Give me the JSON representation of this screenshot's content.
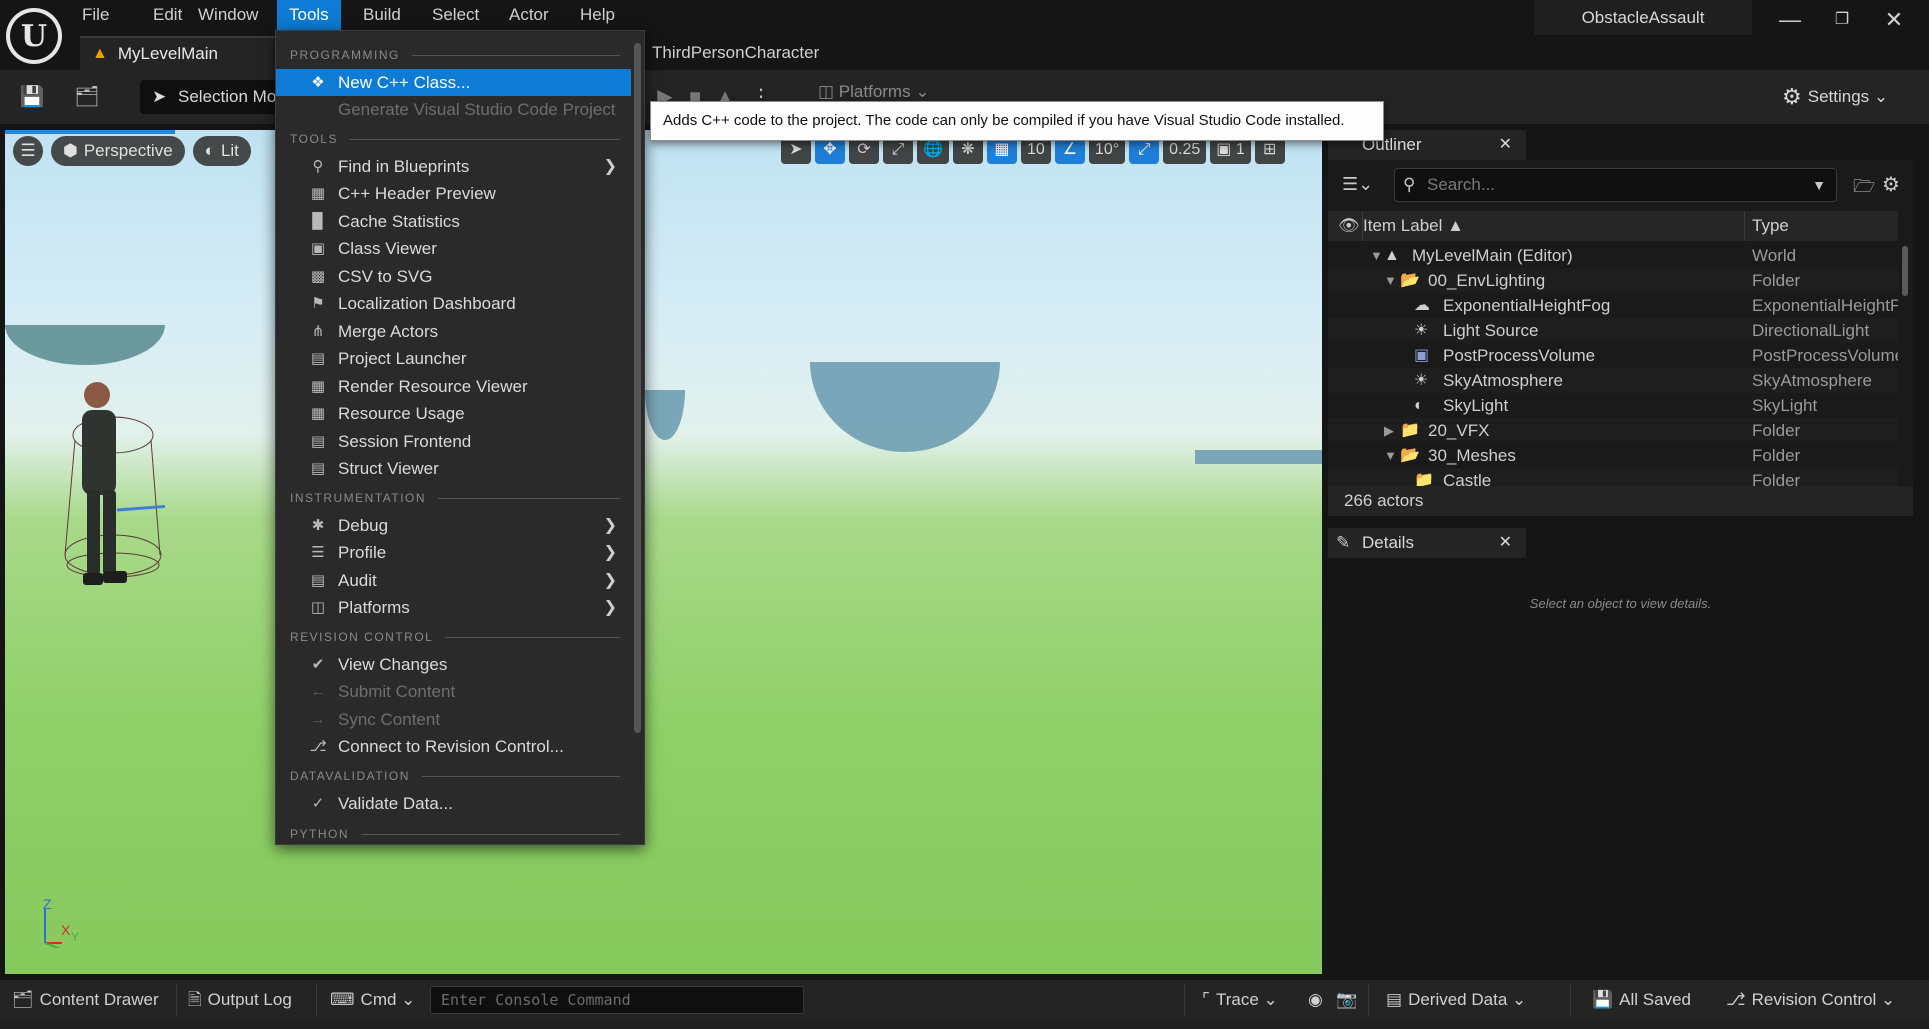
{
  "menubar": {
    "items": [
      "File",
      "Edit",
      "Window",
      "Tools",
      "Build",
      "Select",
      "Actor",
      "Help"
    ],
    "active": "Tools"
  },
  "window": {
    "project_name": "ObstacleAssault"
  },
  "tabs": {
    "level": "MyLevelMain",
    "blueprint": "ThirdPersonCharacter"
  },
  "toolbar": {
    "selection_mode": "Selection Mode",
    "platforms": "Platforms",
    "settings": "Settings"
  },
  "viewport": {
    "perspective": "Perspective",
    "lit": "Lit",
    "grid_snap": "10",
    "rotation_snap": "10°",
    "scale_snap": "0.25",
    "camera_speed": "1",
    "axis_z": "Z",
    "axis_x": "X",
    "axis_y": "Y"
  },
  "tools_menu": {
    "sections": {
      "programming": "PROGRAMMING",
      "tools": "TOOLS",
      "instrumentation": "INSTRUMENTATION",
      "revision_control": "REVISION CONTROL",
      "datavalidation": "DATAVALIDATION",
      "python": "PYTHON"
    },
    "items": {
      "new_cpp_class": "New C++ Class...",
      "generate_vscode": "Generate Visual Studio Code Project",
      "find_in_blueprints": "Find in Blueprints",
      "cpp_header_preview": "C++ Header Preview",
      "cache_statistics": "Cache Statistics",
      "class_viewer": "Class Viewer",
      "csv_to_svg": "CSV to SVG",
      "localization_dashboard": "Localization Dashboard",
      "merge_actors": "Merge Actors",
      "project_launcher": "Project Launcher",
      "render_resource_viewer": "Render Resource Viewer",
      "resource_usage": "Resource Usage",
      "session_frontend": "Session Frontend",
      "struct_viewer": "Struct Viewer",
      "debug": "Debug",
      "profile": "Profile",
      "audit": "Audit",
      "platforms": "Platforms",
      "view_changes": "View Changes",
      "submit_content": "Submit Content",
      "sync_content": "Sync Content",
      "connect_revision_control": "Connect to Revision Control...",
      "validate_data": "Validate Data..."
    }
  },
  "tooltip": {
    "text": "Adds C++ code to the project. The code can only be compiled if you have Visual Studio Code installed."
  },
  "outliner": {
    "title": "Outliner",
    "search_placeholder": "Search...",
    "col_label": "Item Label",
    "col_type": "Type",
    "rows": [
      {
        "label": "MyLevelMain (Editor)",
        "type": "World"
      },
      {
        "label": "00_EnvLighting",
        "type": "Folder"
      },
      {
        "label": "ExponentialHeightFog",
        "type": "ExponentialHeightFog"
      },
      {
        "label": "Light Source",
        "type": "DirectionalLight"
      },
      {
        "label": "PostProcessVolume",
        "type": "PostProcessVolume"
      },
      {
        "label": "SkyAtmosphere",
        "type": "SkyAtmosphere"
      },
      {
        "label": "SkyLight",
        "type": "SkyLight"
      },
      {
        "label": "20_VFX",
        "type": "Folder"
      },
      {
        "label": "30_Meshes",
        "type": "Folder"
      },
      {
        "label": "Castle",
        "type": "Folder"
      }
    ],
    "actor_count": "266 actors"
  },
  "details": {
    "title": "Details",
    "empty_text": "Select an object to view details."
  },
  "statusbar": {
    "content_drawer": "Content Drawer",
    "output_log": "Output Log",
    "cmd": "Cmd",
    "console_placeholder": "Enter Console Command",
    "trace": "Trace",
    "derived_data": "Derived Data",
    "all_saved": "All Saved",
    "revision_control": "Revision Control"
  }
}
